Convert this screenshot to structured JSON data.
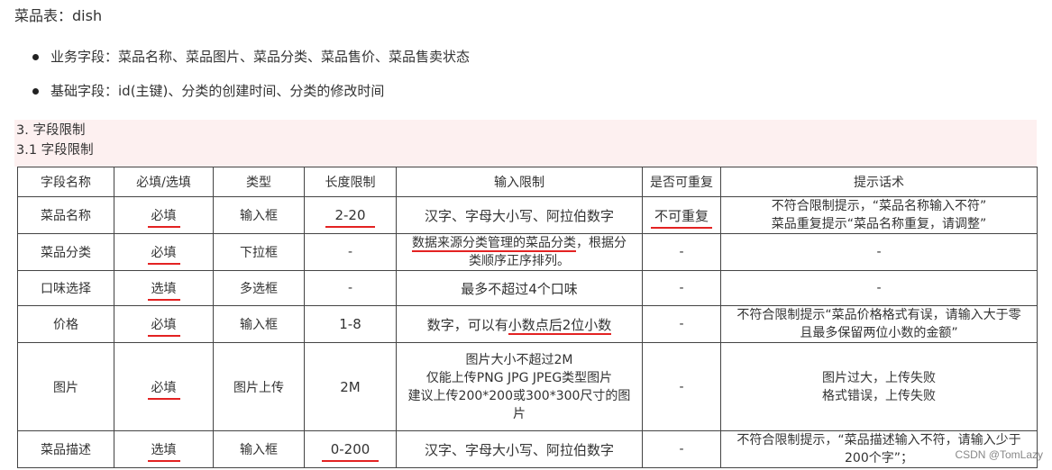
{
  "title": "菜品表：dish",
  "bullets": [
    "业务字段：菜品名称、菜品图片、菜品分类、菜品售价、菜品售卖状态",
    "基础字段：id(主键)、分类的创建时间、分类的修改时间"
  ],
  "section": {
    "h1": "3. 字段限制",
    "h2": "3.1 字段限制"
  },
  "table": {
    "headers": [
      "字段名称",
      "必填/选填",
      "类型",
      "长度限制",
      "输入限制",
      "是否可重复",
      "提示话术"
    ],
    "rows": [
      {
        "name": "菜品名称",
        "required": "必填",
        "type": "输入框",
        "length": "2-20",
        "input": "汉字、字母大小写、阿拉伯数字",
        "repeat": "不可重复",
        "hint1": "不符合限制提示，“菜品名称输入不符”",
        "hint2": "菜品重复提示“菜品名称重复，请调整”"
      },
      {
        "name": "菜品分类",
        "required": "必填",
        "type": "下拉框",
        "length": "-",
        "input_ul": "数据来源分类管理的菜品分类",
        "input_rest1": "，根据分",
        "input_rest2": "类顺序正序排列。",
        "repeat": "-",
        "hint": "-"
      },
      {
        "name": "口味选择",
        "required": "选填",
        "type": "多选框",
        "length": "-",
        "input": "最多不超过4个口味",
        "repeat": "-",
        "hint": "-"
      },
      {
        "name": "价格",
        "required": "必填",
        "type": "输入框",
        "length": "1-8",
        "input_pre": "数字，可以有",
        "input_ul": "小数点后2位小数",
        "repeat": "-",
        "hint1": "不符合限制提示“菜品价格格式有误，请输入大于零",
        "hint2": "且最多保留两位小数的金额”"
      },
      {
        "name": "图片",
        "required": "必填",
        "type": "图片上传",
        "length": "2M",
        "input1": "图片大小不超过2M",
        "input2": "仅能上传PNG JPG JPEG类型图片",
        "input3": "建议上传200*200或300*300尺寸的图",
        "input4": "片",
        "repeat": "-",
        "hint1": "图片过大，上传失败",
        "hint2": "格式错误，上传失败"
      },
      {
        "name": "菜品描述",
        "required": "选填",
        "type": "输入框",
        "length": "0-200",
        "input": "汉字、字母大小写、阿拉伯数字",
        "repeat": "-",
        "hint1": "不符合限制提示，“菜品描述输入不符，请输入少于",
        "hint2": "200个字”；"
      }
    ]
  },
  "watermark": "CSDN @TomLazy"
}
